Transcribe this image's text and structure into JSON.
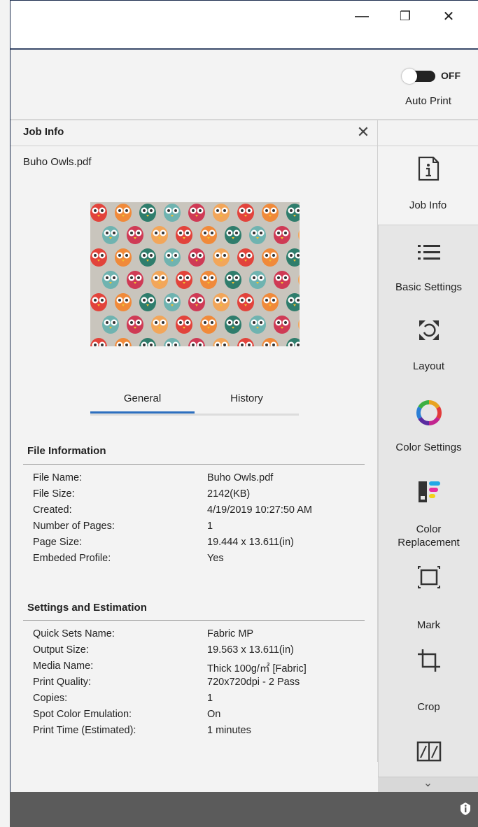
{
  "window": {
    "minimize_glyph": "—",
    "maximize_glyph": "❐",
    "close_glyph": "✕"
  },
  "toolbar": {
    "auto_print_state": "OFF",
    "auto_print_label": "Auto Print"
  },
  "panel": {
    "title": "Job Info",
    "close_glyph": "✕",
    "file_name": "Buho Owls.pdf",
    "tabs": [
      "General",
      "History"
    ],
    "active_tab": "General"
  },
  "file_information": {
    "heading": "File Information",
    "rows": [
      {
        "label": "File Name:",
        "value": "Buho Owls.pdf"
      },
      {
        "label": "File Size:",
        "value": "2142(KB)"
      },
      {
        "label": "Created:",
        "value": "4/19/2019 10:27:50 AM"
      },
      {
        "label": "Number of Pages:",
        "value": "1"
      },
      {
        "label": "Page Size:",
        "value": "19.444 x 13.611(in)"
      },
      {
        "label": "Embeded Profile:",
        "value": "Yes"
      }
    ]
  },
  "settings_estimation": {
    "heading": "Settings and Estimation",
    "rows": [
      {
        "label": "Quick Sets Name:",
        "value": "Fabric MP"
      },
      {
        "label": "Output Size:",
        "value": "19.563 x 13.611(in)"
      },
      {
        "label": "Media Name:",
        "value": "Thick 100g/㎡ [Fabric]"
      },
      {
        "label": "Print Quality:",
        "value": "720x720dpi - 2 Pass"
      },
      {
        "label": "Copies:",
        "value": "1"
      },
      {
        "label": "Spot Color Emulation:",
        "value": "On"
      },
      {
        "label": "Print Time (Estimated):",
        "value": "1 minutes"
      }
    ]
  },
  "sidebar": {
    "items": [
      {
        "label": "Job Info",
        "icon": "info-document-icon"
      },
      {
        "label": "Basic Settings",
        "icon": "list-icon"
      },
      {
        "label": "Layout",
        "icon": "layout-expand-icon"
      },
      {
        "label": "Color Settings",
        "icon": "color-wheel-icon"
      },
      {
        "label": "Color",
        "label2": "Replacement",
        "icon": "color-replacement-icon"
      },
      {
        "label": "Mark",
        "icon": "mark-frame-icon"
      },
      {
        "label": "Crop",
        "icon": "crop-icon"
      },
      {
        "label": "",
        "icon": "book-pages-icon"
      }
    ],
    "scroll_glyph": "⌄"
  },
  "colors": {
    "accent": "#2c6fbf",
    "bottom_bar": "#5b5b5b"
  }
}
